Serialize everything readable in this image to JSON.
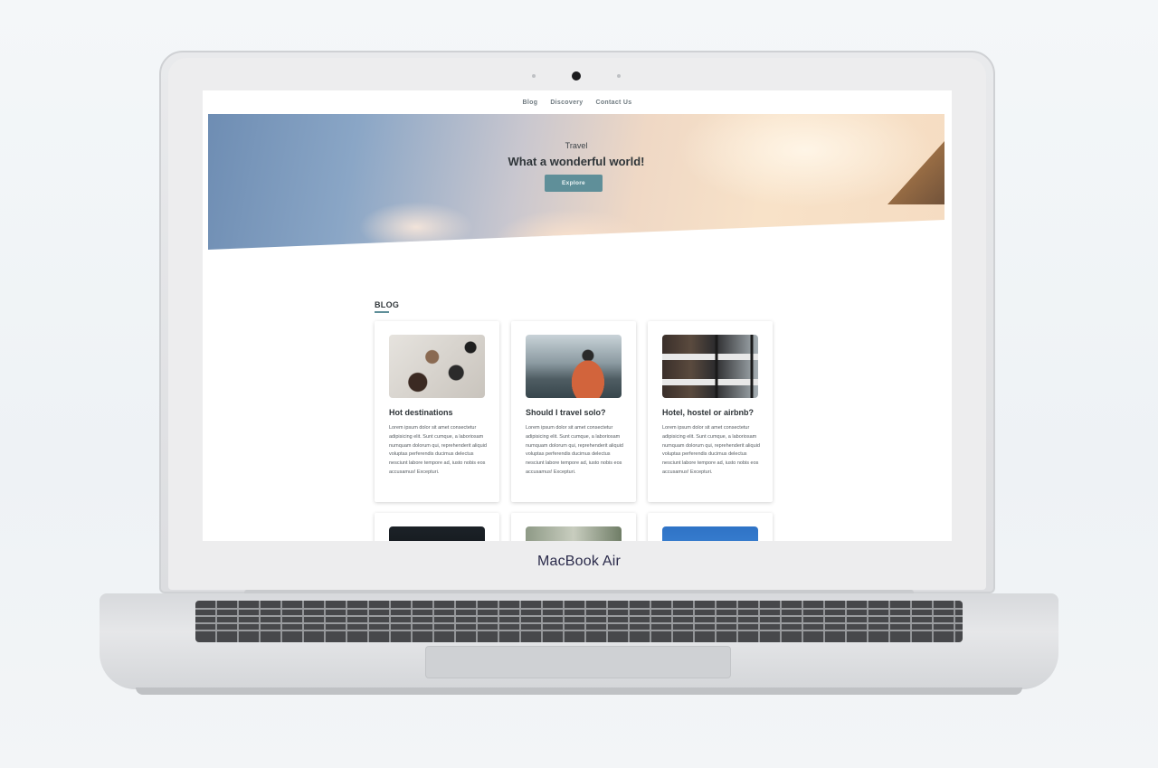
{
  "device": {
    "brand_label": "MacBook Air"
  },
  "nav": {
    "items": [
      "Blog",
      "Discovery",
      "Contact Us"
    ]
  },
  "hero": {
    "subtitle": "Travel",
    "title": "What a wonderful world!",
    "button_label": "Explore"
  },
  "blog": {
    "section_title": "BLOG",
    "cards": [
      {
        "title": "Hot destinations",
        "text": "Lorem ipsum dolor sit amet consectetur adipisicing elit. Sunt cumque, a laboriosam numquam dolorum qui, reprehenderit aliquid voluptas perferendis ducimus delectus nesciunt labore tempore ad, iusto nobis eos accusamus! Excepturi."
      },
      {
        "title": "Should I travel solo?",
        "text": "Lorem ipsum dolor sit amet consectetur adipisicing elit. Sunt cumque, a laboriosam numquam dolorum qui, reprehenderit aliquid voluptas perferendis ducimus delectus nesciunt labore tempore ad, iusto nobis eos accusamus! Excepturi."
      },
      {
        "title": "Hotel, hostel or airbnb?",
        "text": "Lorem ipsum dolor sit amet consectetur adipisicing elit. Sunt cumque, a laboriosam numquam dolorum qui, reprehenderit aliquid voluptas perferendis ducimus delectus nesciunt labore tempore ad, iusto nobis eos accusamus! Excepturi."
      }
    ]
  },
  "colors": {
    "accent": "#5f8f99",
    "heading": "#2f3539",
    "body_text": "#555b60"
  }
}
